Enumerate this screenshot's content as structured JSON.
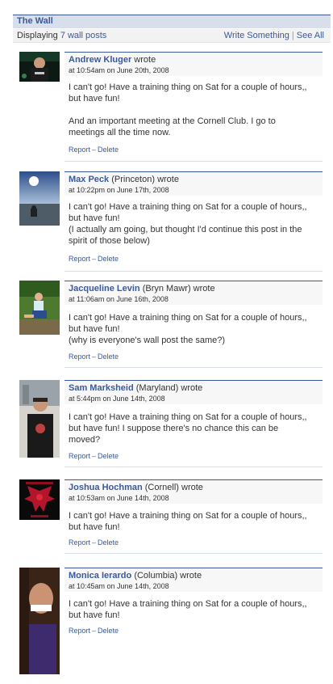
{
  "wall": {
    "title": "The Wall",
    "count_prefix": "Displaying",
    "count_link": "7 wall posts",
    "write_link": "Write Something",
    "separator": "|",
    "see_all_link": "See All"
  },
  "actions": {
    "report": "Report",
    "dash": "–",
    "delete": "Delete"
  },
  "posts": [
    {
      "name": "Andrew Kluger",
      "network": "",
      "wrote": "wrote",
      "timestamp": "at 10:54am on June 20th, 2008",
      "body": "I can't go! Have a training thing on Sat for a couple of hours,, but have fun!\n\nAnd an important meeting at the Cornell Club. I go to meetings all the time now."
    },
    {
      "name": "Max Peck",
      "network": "(Princeton)",
      "wrote": "wrote",
      "timestamp": "at 10:22pm on June 17th, 2008",
      "body": "I can't go! Have a training thing on Sat for a couple of hours,, but have fun!\n(I actually am going, but thought I'd continue this post in the spirit of those below)"
    },
    {
      "name": "Jacqueline Levin",
      "network": "(Bryn Mawr)",
      "wrote": "wrote",
      "timestamp": "at 11:06am on June 16th, 2008",
      "body": "I can't go! Have a training thing on Sat for a couple of hours,, but have fun!\n(why is everyone's wall post the same?)"
    },
    {
      "name": "Sam Marksheid",
      "network": "(Maryland)",
      "wrote": "wrote",
      "timestamp": "at 5:44pm on June 14th, 2008",
      "body": "I can't go! Have a training thing on Sat for a couple of hours,, but have fun! I suppose there's no chance this can be moved?"
    },
    {
      "name": "Joshua Hochman",
      "network": "(Cornell)",
      "wrote": "wrote",
      "timestamp": "at 10:53am on June 14th, 2008",
      "body": "I can't go! Have a training thing on Sat for a couple of hours,, but have fun!"
    },
    {
      "name": "Monica Ierardo",
      "network": "(Columbia)",
      "wrote": "wrote",
      "timestamp": "at 10:45am on June 14th, 2008",
      "body": "I can't go! Have a training thing on Sat for a couple of hours,, but have fun!"
    }
  ]
}
